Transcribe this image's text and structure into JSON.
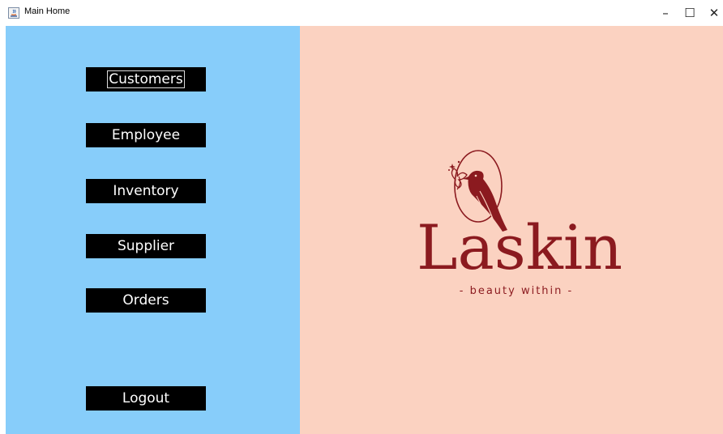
{
  "window": {
    "title": "Main Home",
    "controls": {
      "minimize": "–",
      "maximize": "☐",
      "close": "✕"
    }
  },
  "sidebar": {
    "background": "#87cdfa",
    "buttons": [
      {
        "label": "Customers"
      },
      {
        "label": "Employee"
      },
      {
        "label": "Inventory"
      },
      {
        "label": "Supplier"
      },
      {
        "label": "Orders"
      },
      {
        "label": "Logout"
      }
    ]
  },
  "brand": {
    "background": "#fbd2c1",
    "name": "Laskin",
    "tagline": "- beauty within -",
    "color": "#8b1a1f",
    "icon": "bird-logo-icon"
  }
}
